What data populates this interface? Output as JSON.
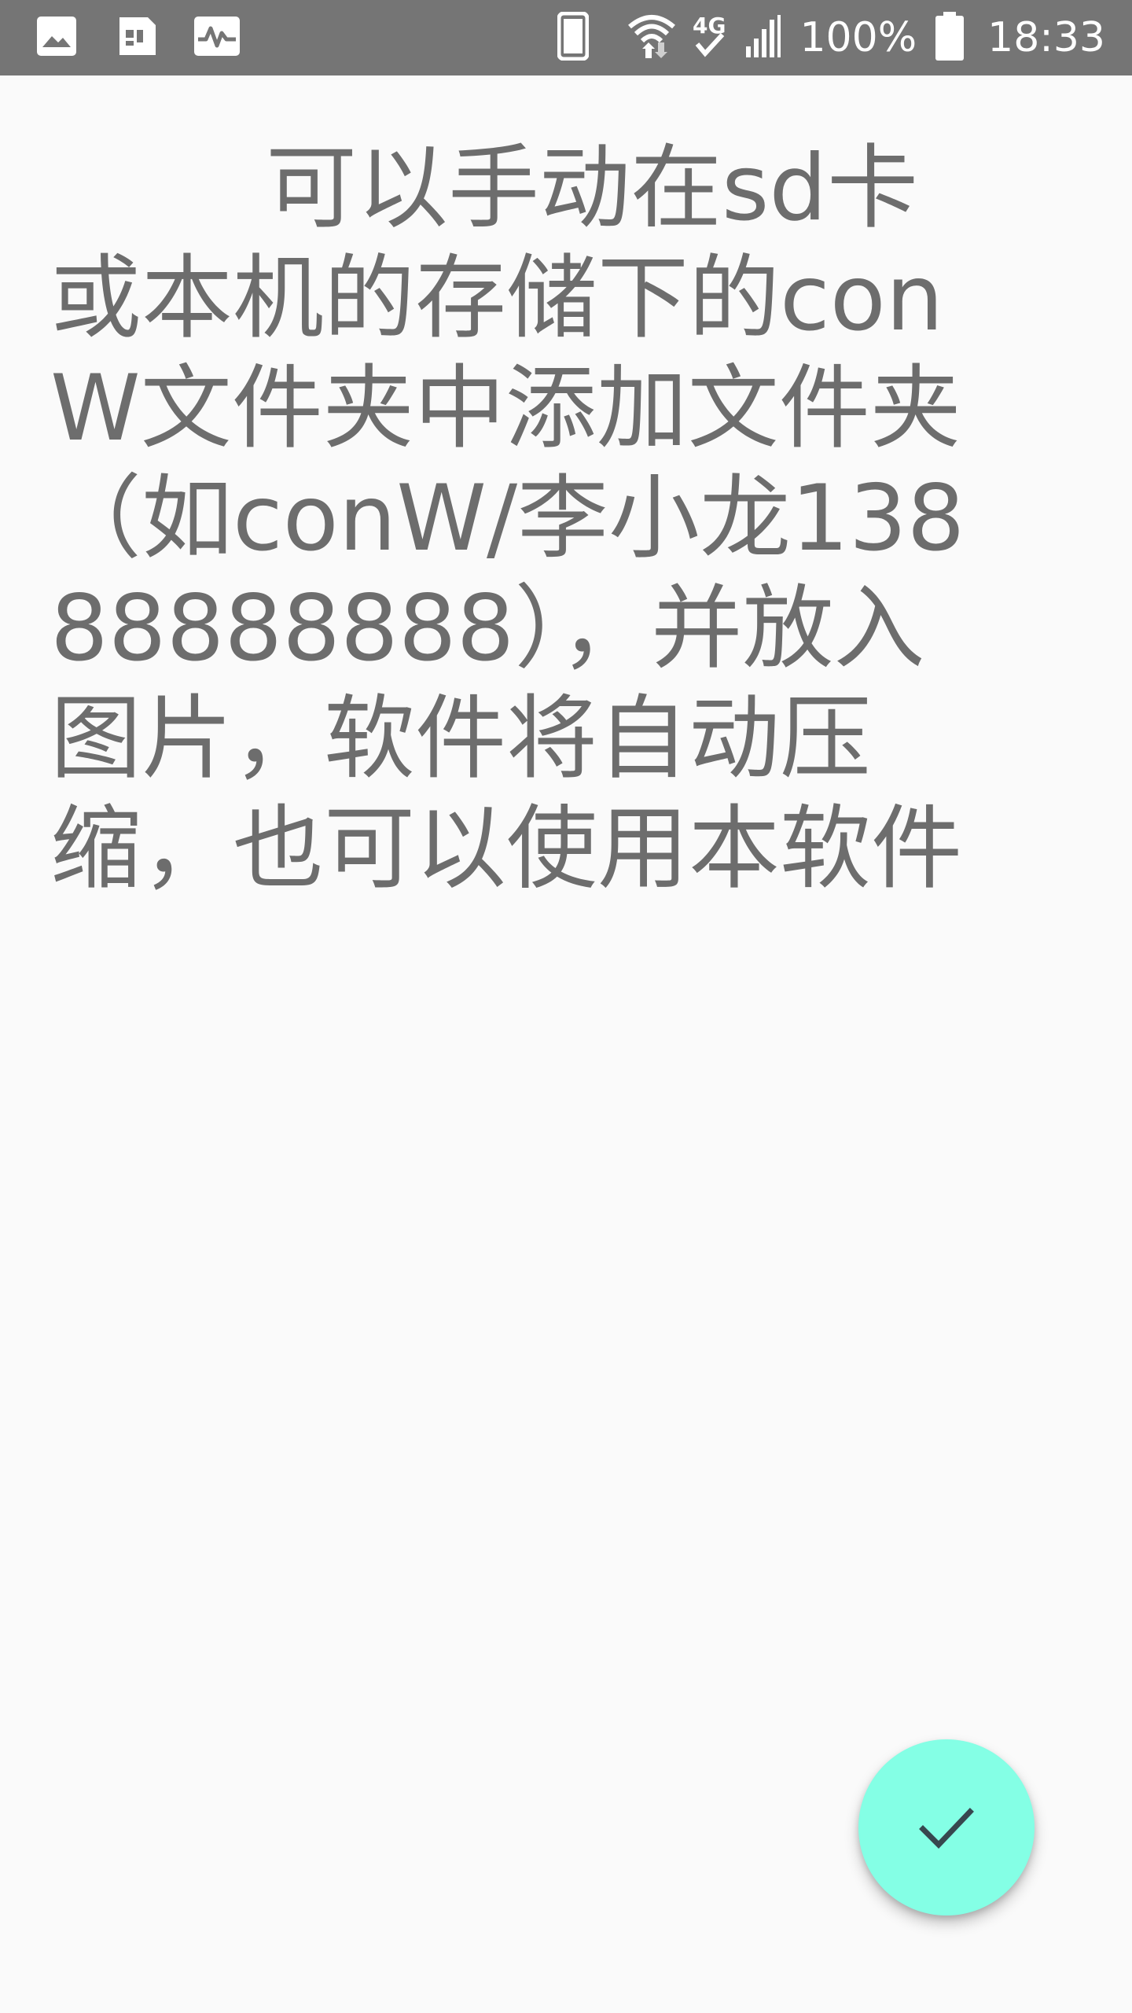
{
  "status_bar": {
    "left_icons": [
      "image-icon",
      "sim-toolkit-icon",
      "activity-icon"
    ],
    "right_icons": [
      "phone-icon",
      "wifi-icon",
      "4g-icon",
      "signal-icon",
      "battery-icon"
    ],
    "network_label": "4G",
    "battery_percent": "100%",
    "time": "18:33"
  },
  "main": {
    "message": "可以手动在sd卡或本机的存储下的conW文件夹中添加文件夹（如conW/李小龙13888888888），并放入图片，软件将自动压缩，也可以使用本软件"
  },
  "fab": {
    "icon": "check-icon",
    "icon_color": "#37474f",
    "background": "#84ffe5"
  },
  "colors": {
    "status_bar": "#757575",
    "background": "#fafafa",
    "text": "#6d6d6d"
  }
}
